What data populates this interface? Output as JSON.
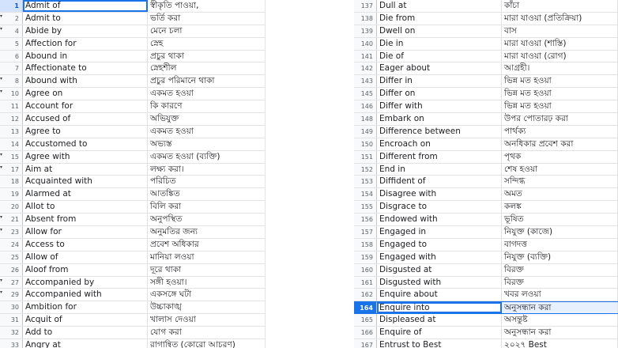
{
  "left_rows": [
    {
      "n": "1",
      "tri": false,
      "en": "Admit of",
      "bn": "স্বীকৃতি পাওয়া,"
    },
    {
      "n": "2",
      "tri": true,
      "en": "Admit to",
      "bn": "ভর্তি করা"
    },
    {
      "n": "4",
      "tri": true,
      "en": "Abide by",
      "bn": "মেনে চলা"
    },
    {
      "n": "5",
      "tri": false,
      "en": "Affection for",
      "bn": "স্নেহ"
    },
    {
      "n": "6",
      "tri": false,
      "en": "Abound in",
      "bn": " প্রচুর থাকা"
    },
    {
      "n": "7",
      "tri": false,
      "en": "Affectionate to",
      "bn": "স্নেহশীল"
    },
    {
      "n": "8",
      "tri": true,
      "en": "Abound with",
      "bn": "প্রচুর পরিমানে থাকা"
    },
    {
      "n": "10",
      "tri": true,
      "en": "Agree on",
      "bn": "একমত হওয়া"
    },
    {
      "n": "11",
      "tri": false,
      "en": "Account for",
      "bn": "কি কারণে"
    },
    {
      "n": "12",
      "tri": false,
      "en": "Accused of",
      "bn": "অভিযুক্ত"
    },
    {
      "n": "13",
      "tri": false,
      "en": "Agree to",
      "bn": " একমত হওয়া"
    },
    {
      "n": "14",
      "tri": false,
      "en": "Accustomed to",
      "bn": "অভ্যস্ত"
    },
    {
      "n": "15",
      "tri": true,
      "en": "Agree with",
      "bn": "একমত হওয়া (ব্যক্তি)"
    },
    {
      "n": "17",
      "tri": true,
      "en": "Aim at",
      "bn": "লক্ষ্য করা।"
    },
    {
      "n": "18",
      "tri": false,
      "en": "Acquainted with",
      "bn": "পরিচিত"
    },
    {
      "n": "19",
      "tri": false,
      "en": "Alarmed at",
      "bn": "আতঙ্কিত"
    },
    {
      "n": "20",
      "tri": false,
      "en": "Allot to",
      "bn": "বিলি করা"
    },
    {
      "n": "21",
      "tri": true,
      "en": "Absent from",
      "bn": "অনুপস্থিত"
    },
    {
      "n": "23",
      "tri": true,
      "en": "Allow for",
      "bn": "অনুমতির জন্য"
    },
    {
      "n": "24",
      "tri": false,
      "en": "Access to",
      "bn": "প্রবেশ অধিকার"
    },
    {
      "n": "25",
      "tri": false,
      "en": "Allow of",
      "bn": "মানিয়া লওয়া"
    },
    {
      "n": "26",
      "tri": false,
      "en": "Aloof from",
      "bn": "দূরে থাকা"
    },
    {
      "n": "27",
      "tri": true,
      "en": "Accompanied by",
      "bn": "সঙ্গী হওয়া।"
    },
    {
      "n": "29",
      "tri": true,
      "en": "Accompanied with",
      "bn": "একসঙ্গে ঘটা"
    },
    {
      "n": "30",
      "tri": false,
      "en": "Ambition for",
      "bn": "উচ্চাকাঙ্খ"
    },
    {
      "n": "31",
      "tri": false,
      "en": "Acquit of",
      "bn": "খালাস দেওয়া"
    },
    {
      "n": "32",
      "tri": false,
      "en": "Add to",
      "bn": "যোগ করা"
    },
    {
      "n": "33",
      "tri": false,
      "en": "Angry at",
      "bn": "রাগান্বিত (কোরো আচরণ)"
    }
  ],
  "right_rows": [
    {
      "n": "137",
      "en": "Dull at",
      "bn": "কাঁচা"
    },
    {
      "n": "138",
      "en": "Die from",
      "bn": "মারা যাওয়া (প্রতিক্রিয়া)"
    },
    {
      "n": "139",
      "en": "Dwell on",
      "bn": "বাস"
    },
    {
      "n": "140",
      "en": "Die in",
      "bn": "মারা যাওয়া (শাস্তি)"
    },
    {
      "n": "141",
      "en": "Die of",
      "bn": "মারা যাওয়া (রোগ)"
    },
    {
      "n": "142",
      "en": "Eager about",
      "bn": "আগ্রহী।"
    },
    {
      "n": "143",
      "en": "Differ in",
      "bn": "ভিন্ন মত হওয়া"
    },
    {
      "n": "145",
      "en": "Differ on",
      "bn": "ভিন্ন মত হওয়া"
    },
    {
      "n": "146",
      "en": "Differ with",
      "bn": "ভিন্ন মত হওয়া"
    },
    {
      "n": "148",
      "en": "Embark on",
      "bn": "উপর পোতারঢ় করা"
    },
    {
      "n": "149",
      "en": "Difference between",
      "bn": "পার্থক্য"
    },
    {
      "n": "150",
      "en": "Encroach on",
      "bn": "অনধিকার প্রবেশ করা"
    },
    {
      "n": "151",
      "en": "Different from",
      "bn": "পৃথক"
    },
    {
      "n": "152",
      "en": "End in",
      "bn": "শেষ হওয়া"
    },
    {
      "n": "153",
      "en": "Diffident of",
      "bn": "সন্দিগ্ধ"
    },
    {
      "n": "154",
      "en": "Disagree with",
      "bn": "অমত"
    },
    {
      "n": "155",
      "en": "Disgrace to",
      "bn": "কলঙ্ক"
    },
    {
      "n": "156",
      "en": "Endowed with",
      "bn": "ভূষিত"
    },
    {
      "n": "157",
      "en": "Engaged in",
      "bn": "নিযুক্ত (কাজে)"
    },
    {
      "n": "158",
      "en": "Engaged to",
      "bn": "বাগদত্ত"
    },
    {
      "n": "159",
      "en": "Engaged with",
      "bn": "নিযুক্ত (ব্যক্তি)"
    },
    {
      "n": "160",
      "en": "Disgusted at",
      "bn": "বিরক্ত"
    },
    {
      "n": "161",
      "en": "Disgusted with",
      "bn": "বিরক্ত"
    },
    {
      "n": "162",
      "en": "Enquire about",
      "bn": "খবর লওয়া"
    },
    {
      "n": "164",
      "en": "Enquire into",
      "bn": "অনুসন্ধান করা",
      "sel": true
    },
    {
      "n": "165",
      "en": "Displeased at",
      "bn": "অসন্তুষ্ট"
    },
    {
      "n": "166",
      "en": "Enquire of",
      "bn": "অনুসন্ধান করা"
    },
    {
      "n": "167",
      "en": "Entrust to Best",
      "bn": "২০২৭ Best"
    }
  ]
}
